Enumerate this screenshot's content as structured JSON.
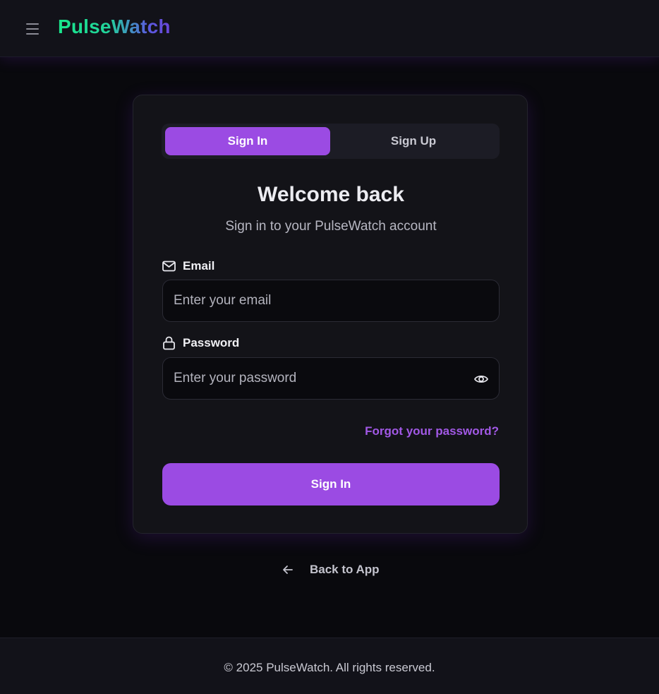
{
  "header": {
    "menu_icon": "hamburger-menu-icon",
    "brand": "PulseWatch"
  },
  "auth": {
    "tabs": [
      {
        "label": "Sign In",
        "active": true
      },
      {
        "label": "Sign Up",
        "active": false
      }
    ],
    "title": "Welcome back",
    "subtitle": "Sign in to your PulseWatch account",
    "email": {
      "label": "Email",
      "icon": "mail-icon",
      "placeholder": "Enter your email",
      "value": ""
    },
    "password": {
      "label": "Password",
      "icon": "lock-icon",
      "placeholder": "Enter your password",
      "value": "",
      "toggle_icon": "eye-icon"
    },
    "forgot_link": "Forgot your password?",
    "submit_label": "Sign In"
  },
  "back_link": {
    "icon": "arrow-left-icon",
    "label": "Back to App"
  },
  "footer": {
    "text": "© 2025 PulseWatch. All rights reserved."
  },
  "colors": {
    "accent": "#9b4be3",
    "link": "#a259e6",
    "background": "#09090d",
    "card": "#131318",
    "brand_gradient_start": "#19e68c",
    "brand_gradient_end": "#6a45d8"
  }
}
